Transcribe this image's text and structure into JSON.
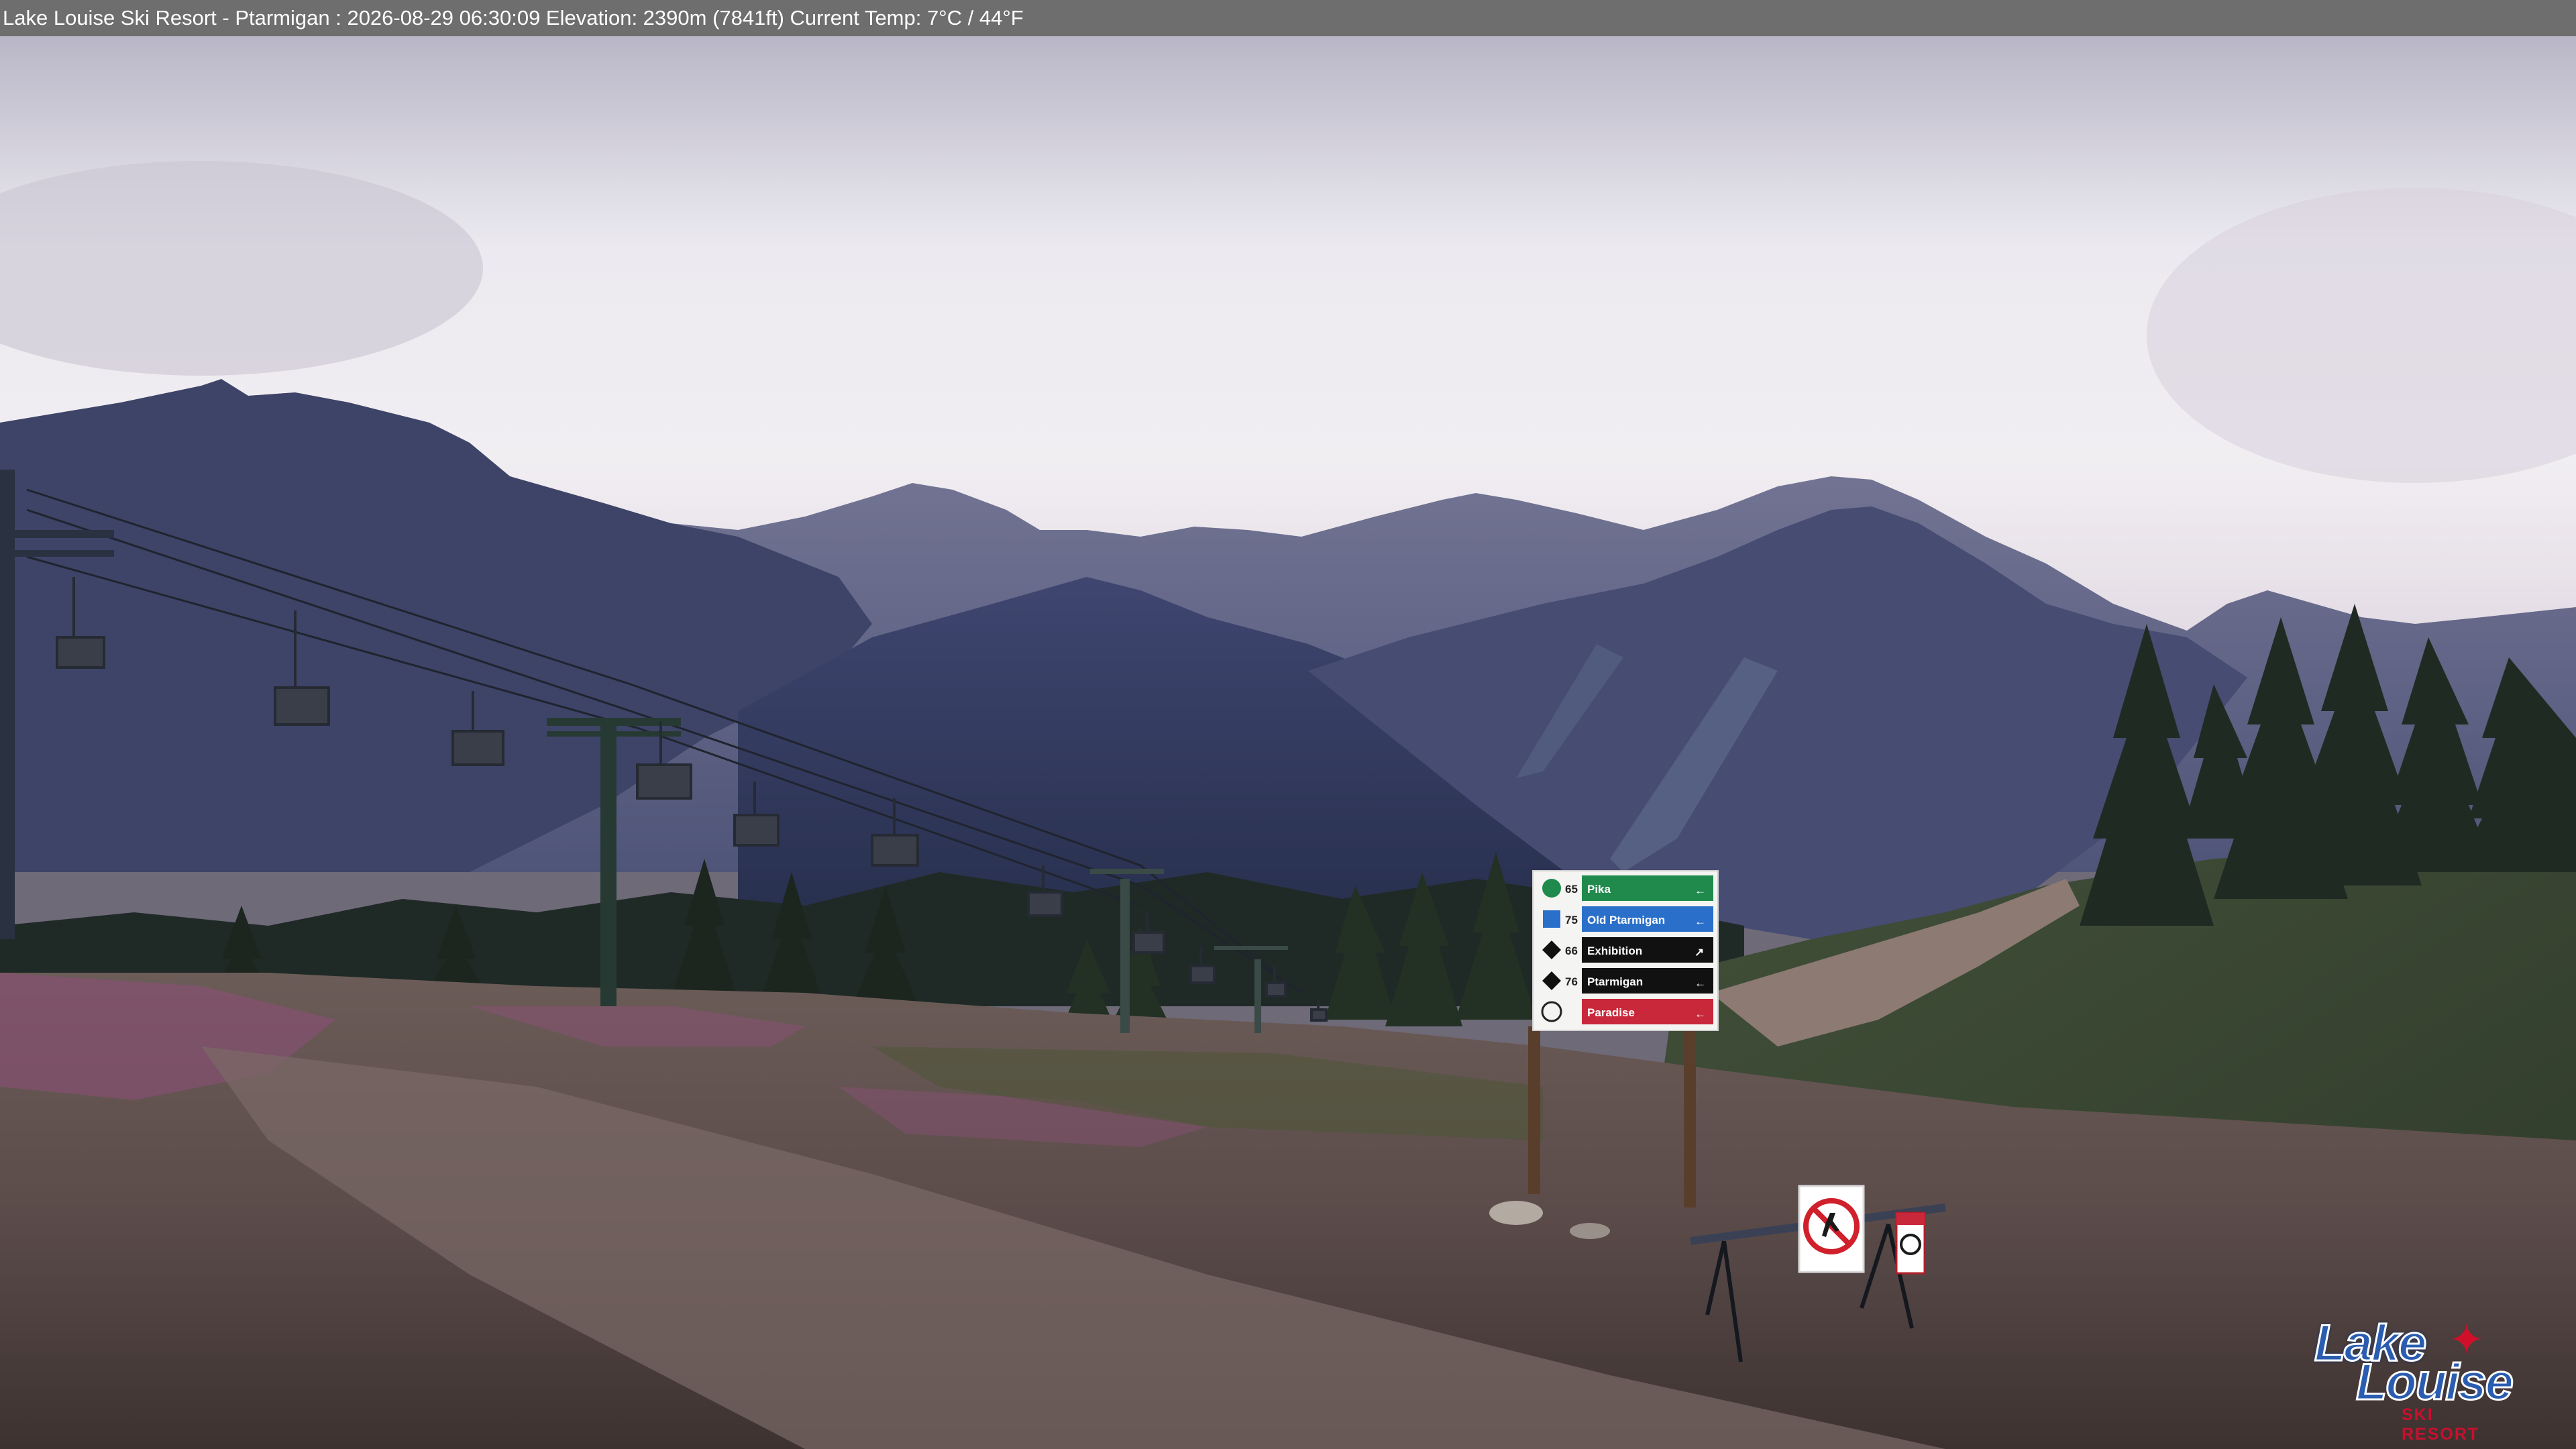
{
  "overlay": {
    "caption": "Lake Louise Ski Resort - Ptarmigan : 2026-08-29 06:30:09  Elevation: 2390m (7841ft) Current Temp: 7°C / 44°F"
  },
  "trail_sign": {
    "rows": [
      {
        "number": "65",
        "name": "Pika",
        "arrow": "←",
        "color": "#1f8a4c",
        "difficulty_icon": "green-circle-icon"
      },
      {
        "number": "75",
        "name": "Old Ptarmigan",
        "arrow": "←",
        "color": "#2a6fc9",
        "difficulty_icon": "blue-square-icon"
      },
      {
        "number": "66",
        "name": "Exhibition",
        "arrow": "↗",
        "color": "#111111",
        "difficulty_icon": "double-black-diamond-icon"
      },
      {
        "number": "76",
        "name": "Ptarmigan",
        "arrow": "←",
        "color": "#111111",
        "difficulty_icon": "black-diamond-icon"
      },
      {
        "number": "",
        "name": "Paradise",
        "arrow": "←",
        "color": "#c8283a",
        "difficulty_icon": "lodge-icon"
      }
    ]
  },
  "logo": {
    "line1": "Lake",
    "line2": "Louise",
    "line3": "SKI RESORT",
    "icon": "maple-leaf-icon"
  },
  "colors": {
    "sky": "#ece8ef",
    "mountains": "#3b4166",
    "meadow": "#6f5a52",
    "overlay_bar": "#6f6e6f"
  }
}
